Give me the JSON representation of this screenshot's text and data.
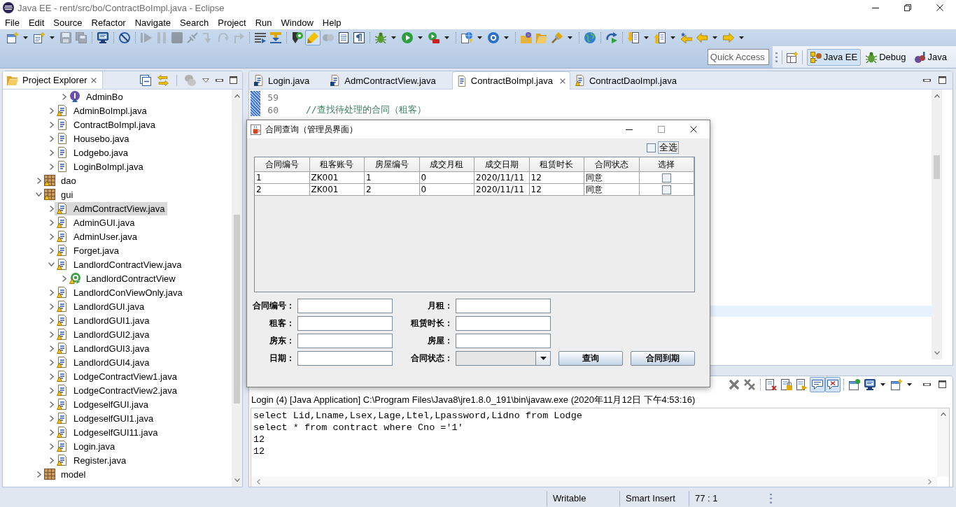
{
  "window": {
    "title": "Java EE - rent/src/bo/ContractBoImpl.java - Eclipse"
  },
  "menu": [
    "File",
    "Edit",
    "Source",
    "Refactor",
    "Navigate",
    "Search",
    "Project",
    "Run",
    "Window",
    "Help"
  ],
  "main_toolbar": {
    "buttons": [
      {
        "disabled": false,
        "pressed": false
      },
      {
        "disabled": false,
        "pressed": false
      },
      {
        "disabled": true,
        "pressed": false
      },
      {
        "disabled": true,
        "pressed": false
      },
      {
        "disabled": false,
        "pressed": false
      },
      {
        "disabled": false,
        "pressed": false
      },
      {
        "disabled": true,
        "pressed": false
      },
      {
        "disabled": true,
        "pressed": false
      },
      {
        "disabled": true,
        "pressed": false
      },
      {
        "disabled": true,
        "pressed": false
      },
      {
        "disabled": true,
        "pressed": false
      },
      {
        "disabled": true,
        "pressed": false
      },
      {
        "disabled": true,
        "pressed": false
      },
      {
        "disabled": false,
        "pressed": false
      },
      {
        "disabled": false,
        "pressed": false
      },
      {
        "disabled": false,
        "pressed": false
      },
      {
        "disabled": false,
        "pressed": true
      },
      {
        "disabled": true,
        "pressed": false
      },
      {
        "disabled": false,
        "pressed": false
      },
      {
        "disabled": false,
        "pressed": false
      },
      {
        "disabled": false,
        "pressed": false
      },
      {
        "disabled": false,
        "pressed": false
      },
      {
        "disabled": false,
        "pressed": false
      },
      {
        "disabled": false,
        "pressed": false
      },
      {
        "disabled": false,
        "pressed": false
      },
      {
        "disabled": false,
        "pressed": false
      },
      {
        "disabled": false,
        "pressed": false
      },
      {
        "disabled": false,
        "pressed": false
      },
      {
        "disabled": false,
        "pressed": false
      },
      {
        "disabled": false,
        "pressed": false
      },
      {
        "disabled": false,
        "pressed": false
      },
      {
        "disabled": false,
        "pressed": false
      },
      {
        "disabled": false,
        "pressed": false
      },
      {
        "disabled": false,
        "pressed": false
      },
      {
        "disabled": false,
        "pressed": false
      }
    ]
  },
  "quick_access": {
    "placeholder": "Quick Access"
  },
  "perspectives": [
    {
      "label": "Java EE",
      "selected": true
    },
    {
      "label": "Debug",
      "selected": false
    },
    {
      "label": "Java",
      "selected": false
    }
  ],
  "project_explorer": {
    "title": "Project Explorer",
    "items": [
      {
        "children": [
          {
            "children": [
              {
                "label": "AdminBo",
                "kind": "interface",
                "expanded": false,
                "selected": false,
                "warning": false
              }
            ]
          },
          {
            "label": "AdminBoImpl.java",
            "kind": "java",
            "expanded": false,
            "selected": false,
            "warning": true
          },
          {
            "label": "ContractBoImpl.java",
            "kind": "java",
            "expanded": false,
            "selected": false,
            "warning": false
          },
          {
            "label": "Housebo.java",
            "kind": "java",
            "expanded": false,
            "selected": false,
            "warning": false
          },
          {
            "label": "Lodgebo.java",
            "kind": "java",
            "expanded": false,
            "selected": false,
            "warning": false
          },
          {
            "label": "LoginBoImpl.java",
            "kind": "java",
            "expanded": false,
            "selected": false,
            "warning": false
          }
        ]
      },
      {
        "label": "dao",
        "kind": "package",
        "expanded": false,
        "selected": false,
        "warning": true
      },
      {
        "label": "gui",
        "kind": "package",
        "expanded": true,
        "selected": false,
        "warning": true,
        "children": [
          {
            "label": "AdmContractView.java",
            "kind": "java",
            "expanded": false,
            "selected": true,
            "warning": true
          },
          {
            "label": "AdminGUI.java",
            "kind": "java",
            "expanded": false,
            "selected": false,
            "warning": true
          },
          {
            "label": "AdminUser.java",
            "kind": "java",
            "expanded": false,
            "selected": false,
            "warning": true
          },
          {
            "label": "Forget.java",
            "kind": "java",
            "expanded": false,
            "selected": false,
            "warning": true
          },
          {
            "label": "LandlordContractView.java",
            "kind": "java",
            "expanded": true,
            "selected": false,
            "warning": true,
            "children": [
              {
                "label": "LandlordContractView",
                "kind": "class",
                "expanded": false,
                "selected": false,
                "warning": true
              }
            ]
          },
          {
            "label": "LandlordConViewOnly.java",
            "kind": "java",
            "expanded": false,
            "selected": false,
            "warning": true
          },
          {
            "label": "LandlordGUI.java",
            "kind": "java",
            "expanded": false,
            "selected": false,
            "warning": true
          },
          {
            "label": "LandlordGUI1.java",
            "kind": "java",
            "expanded": false,
            "selected": false,
            "warning": true
          },
          {
            "label": "LandlordGUI2.java",
            "kind": "java",
            "expanded": false,
            "selected": false,
            "warning": true
          },
          {
            "label": "LandlordGUI3.java",
            "kind": "java",
            "expanded": false,
            "selected": false,
            "warning": true
          },
          {
            "label": "LandlordGUI4.java",
            "kind": "java",
            "expanded": false,
            "selected": false,
            "warning": true
          },
          {
            "label": "LodgeContractView1.java",
            "kind": "java",
            "expanded": false,
            "selected": false,
            "warning": true
          },
          {
            "label": "LodgeContractView2.java",
            "kind": "java",
            "expanded": false,
            "selected": false,
            "warning": true
          },
          {
            "label": "LodgeselfGUI.java",
            "kind": "java",
            "expanded": false,
            "selected": false,
            "warning": true
          },
          {
            "label": "LodgeselfGUI1.java",
            "kind": "java",
            "expanded": false,
            "selected": false,
            "warning": true
          },
          {
            "label": "LodgeselfGUI11.java",
            "kind": "java",
            "expanded": false,
            "selected": false,
            "warning": true
          },
          {
            "label": "Login.java",
            "kind": "java",
            "expanded": false,
            "selected": false,
            "warning": true
          },
          {
            "label": "Register.java",
            "kind": "java",
            "expanded": false,
            "selected": false,
            "warning": true
          }
        ]
      },
      {
        "label": "model",
        "kind": "package",
        "expanded": false,
        "selected": false,
        "warning": false
      }
    ]
  },
  "editor": {
    "tabs": [
      {
        "label": "Login.java",
        "selected": false,
        "kind": "main"
      },
      {
        "label": "AdmContractView.java",
        "selected": false,
        "kind": "main"
      },
      {
        "label": "ContractBoImpl.java",
        "selected": true,
        "kind": "plain"
      },
      {
        "label": "ContractDaoImpl.java",
        "selected": false,
        "kind": "warning"
      }
    ],
    "lines": [
      {
        "number": "59"
      },
      {
        "number": "60",
        "kind": "comment",
        "text": "//查找待处理的合同（租客）"
      }
    ]
  },
  "console_toolbar": {
    "buttons": [
      {
        "pressed": false
      },
      {
        "pressed": false
      },
      {
        "pressed": false
      },
      {
        "pressed": false
      },
      {
        "pressed": false
      },
      {
        "pressed": true
      },
      {
        "pressed": true
      },
      {
        "pressed": false
      },
      {
        "pressed": false
      },
      {
        "pressed": false
      }
    ]
  },
  "console": {
    "header": "Login (4) [Java Application] C:\\Program Files\\Java8\\jre1.8.0_191\\bin\\javaw.exe (2020年11月12日 下午4:53:16)",
    "lines": [
      "select Lid,Lname,Lsex,Lage,Ltel,Lpassword,Lidno from Lodge",
      "select * from contract where Cno ='1'",
      "12",
      "12"
    ]
  },
  "status_bar": [
    "Writable",
    "Smart Insert",
    "77 : 1"
  ],
  "dialog": {
    "title": "合同查询（管理员界面）",
    "maximize": {
      "disabled": true
    },
    "select_all": {
      "label": "全选",
      "checked": false
    },
    "table": {
      "columns": [
        "合同编号",
        "租客账号",
        "房屋编号",
        "成交月租",
        "成交日期",
        "租赁时长",
        "合同状态",
        "选择"
      ],
      "rows": [
        {
          "cells": [
            "1",
            "ZK001",
            "1",
            "0",
            "2020/11/11",
            "12",
            "同意"
          ],
          "checked": false
        },
        {
          "cells": [
            "2",
            "ZK001",
            "2",
            "0",
            "2020/11/11",
            "12",
            "同意"
          ],
          "checked": false
        }
      ]
    },
    "fields": [
      {
        "label": "合同编号：",
        "kind": "text"
      },
      {
        "label": "月租：",
        "kind": "text"
      },
      {
        "label": "租客：",
        "kind": "text"
      },
      {
        "label": "租赁时长：",
        "kind": "text"
      },
      {
        "label": "房东：",
        "kind": "text"
      },
      {
        "label": "房屋：",
        "kind": "text"
      },
      {
        "label": "日期：",
        "kind": "text"
      },
      {
        "label": "合同状态：",
        "kind": "combo"
      }
    ],
    "buttons": [
      "查询",
      "合同到期"
    ]
  }
}
